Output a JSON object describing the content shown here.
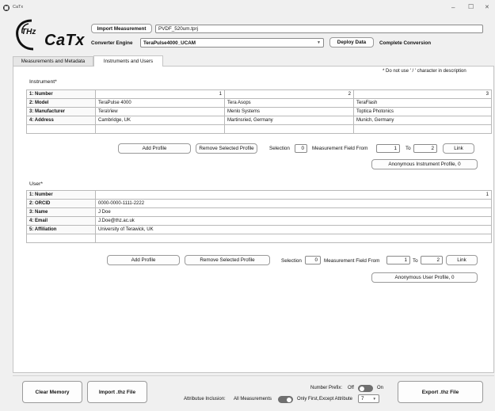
{
  "window": {
    "title": "CaTx",
    "minimize": "–",
    "maximize": "☐",
    "close": "✕"
  },
  "logo": {
    "thz": "THz",
    "catx": "CaTx"
  },
  "top": {
    "import_label": "Import Measurement",
    "file_value": "PVDF_520um.tprj",
    "engine_label": "Converter Engine",
    "engine_value": "TeraPulse4000_UCAM",
    "deploy_label": "Deploy Data",
    "status_text": "Complete Conversion"
  },
  "tabs": [
    {
      "label": "Measurements and Metadata"
    },
    {
      "label": "Instruments and Users"
    }
  ],
  "note": "* Do not use ' / ' character in description",
  "instrument": {
    "title": "Instrument*",
    "rows": [
      {
        "label": "1: Number",
        "cells": [
          "1",
          "2",
          "3"
        ]
      },
      {
        "label": "2: Model",
        "cells": [
          "TeraPulse 4000",
          "Tera Asops",
          "TeraFlash"
        ]
      },
      {
        "label": "3: Manufacturer",
        "cells": [
          "TeraView",
          "Menlo Systems",
          "Toptica Photonics"
        ]
      },
      {
        "label": "4: Address",
        "cells": [
          "Cambridge, UK",
          "Martinsried, Germany",
          "Munich, Germany"
        ]
      }
    ],
    "add_label": "Add Profile",
    "remove_label": "Remove Selected Profile",
    "selection_label": "Selection",
    "selection_value": "0",
    "field_from_label": "Measurement Field From",
    "from_value": "1",
    "to_label": "To",
    "to_value": "2",
    "link_label": "Link",
    "anonymous_label": "Anonymous Instrument Profile, 0"
  },
  "user": {
    "title": "User*",
    "rows": [
      {
        "label": "1: Number",
        "value": "1"
      },
      {
        "label": "2: ORCID",
        "value": "0000-0000-1111-2222"
      },
      {
        "label": "3: Name",
        "value": "J Doe"
      },
      {
        "label": "4: Email",
        "value": "J.Doe@thz.ac.uk"
      },
      {
        "label": "5: Affiliation",
        "value": "University of Terawick, UK"
      }
    ],
    "add_label": "Add Profile",
    "remove_label": "Remove Selected Profile",
    "selection_label": "Selection",
    "selection_value": "0",
    "field_from_label": "Measurement Field From",
    "from_value": "1",
    "to_label": "To",
    "to_value": "2",
    "link_label": "Link",
    "anonymous_label": "Anonymous User Profile, 0"
  },
  "bottom": {
    "clear_label": "Clear Memory",
    "import_thz_label": "Import .thz File",
    "export_label": "Export .thz File",
    "number_prefix_label": "Number Prefix:",
    "off_label": "Off",
    "on_label": "On",
    "inclusion_label": "Attributue Inclusion:",
    "all_measurements_label": "All Measurements",
    "only_first_label": "Only First,",
    "except_label": "Except Attribute",
    "except_value": "7"
  }
}
